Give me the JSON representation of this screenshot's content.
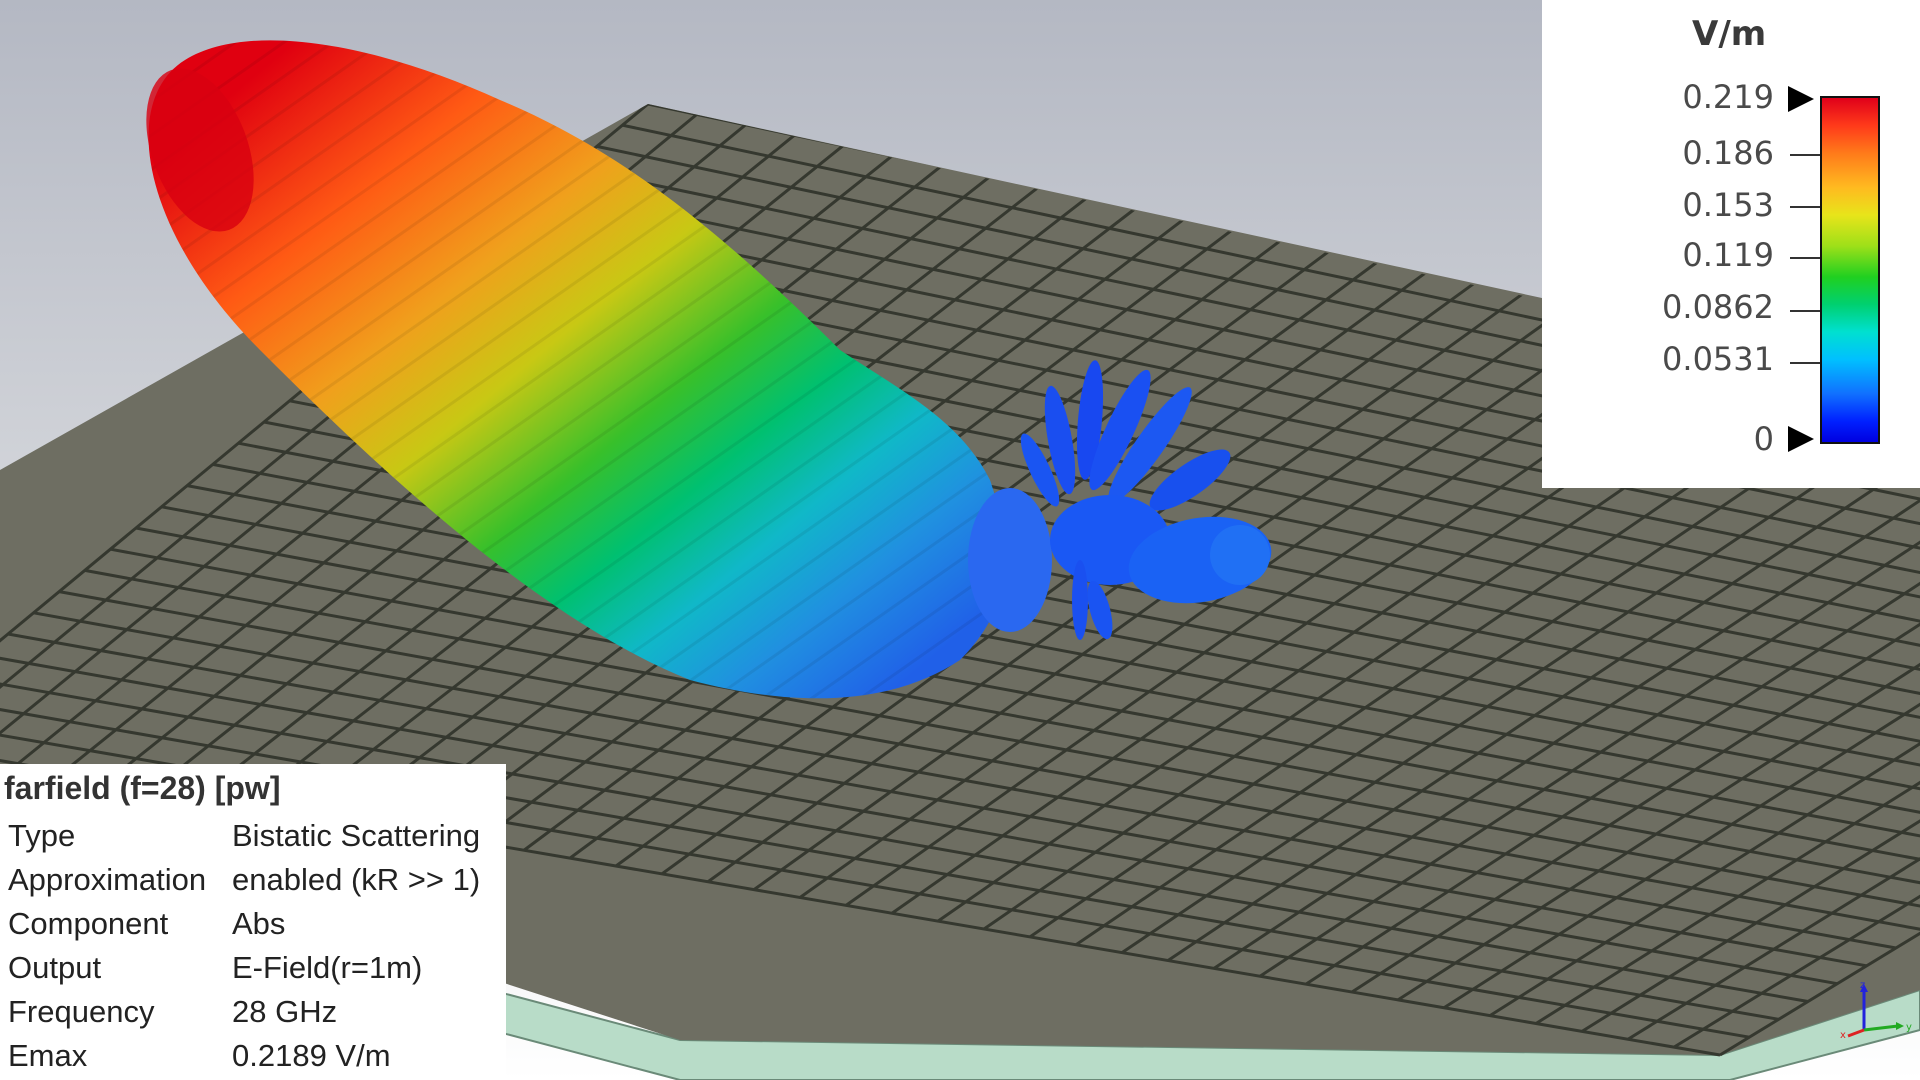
{
  "legend": {
    "unit": "V/m",
    "ticks": [
      "0.219",
      "0.186",
      "0.153",
      "0.119",
      "0.0862",
      "0.0531",
      "0"
    ],
    "colors": {
      "max": "#e0001a",
      "mid": "#20d020",
      "min": "#0000e0"
    }
  },
  "info": {
    "title": "farfield (f=28) [pw]",
    "rows": [
      {
        "key": "Type",
        "value": "Bistatic Scattering"
      },
      {
        "key": "Approximation",
        "value": "enabled (kR >> 1)"
      },
      {
        "key": "Component",
        "value": "Abs"
      },
      {
        "key": "Output",
        "value": "E-Field(r=1m)"
      },
      {
        "key": "Frequency",
        "value": "28 GHz"
      },
      {
        "key": "Emax",
        "value": "0.2189 V/m"
      }
    ]
  },
  "triad": {
    "z": "z",
    "y": "y",
    "x": "x"
  },
  "scene": {
    "background_top": "#b8bcc6",
    "background_bottom": "#ffffff",
    "panel_color": "#6e6e62",
    "grid_line_color": "#3c3f38",
    "substrate_color": "#b8dcc8"
  }
}
